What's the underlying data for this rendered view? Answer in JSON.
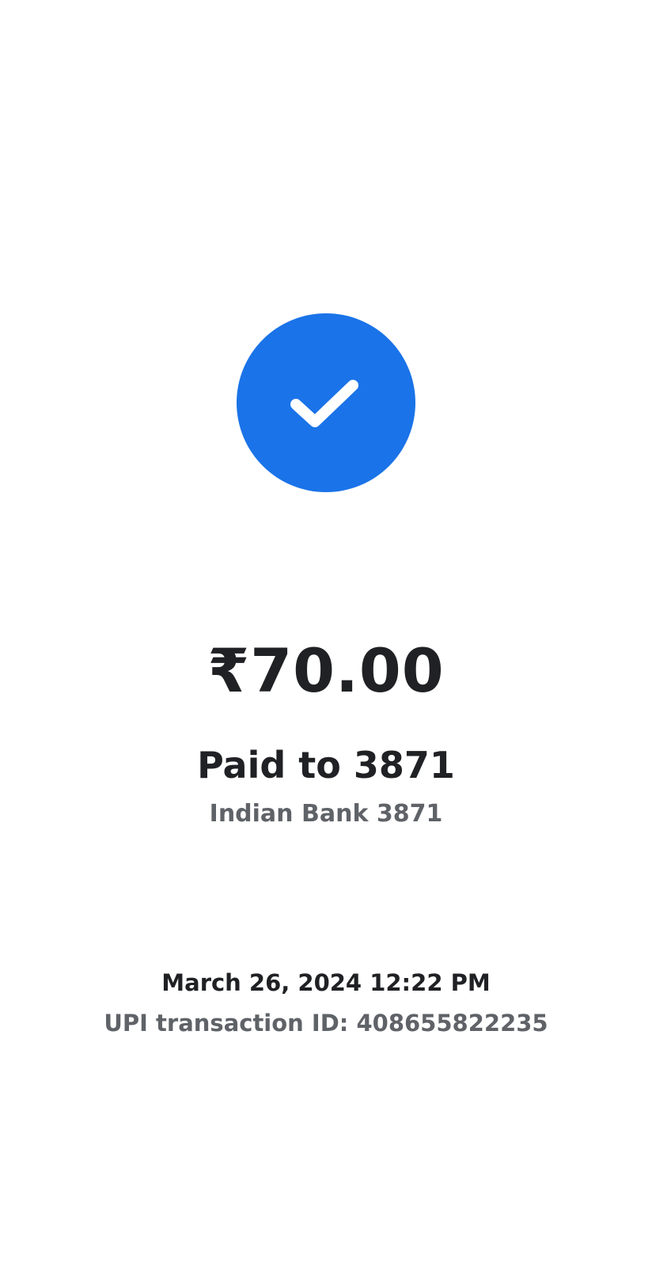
{
  "status": {
    "icon": "check-circle-icon",
    "color": "#1a73e8"
  },
  "payment": {
    "amount": "₹70.00",
    "paid_to": "Paid to 3871",
    "bank": "Indian Bank 3871"
  },
  "transaction": {
    "datetime": "March 26, 2024 12:22 PM",
    "upi_id": "UPI transaction ID: 408655822235"
  }
}
